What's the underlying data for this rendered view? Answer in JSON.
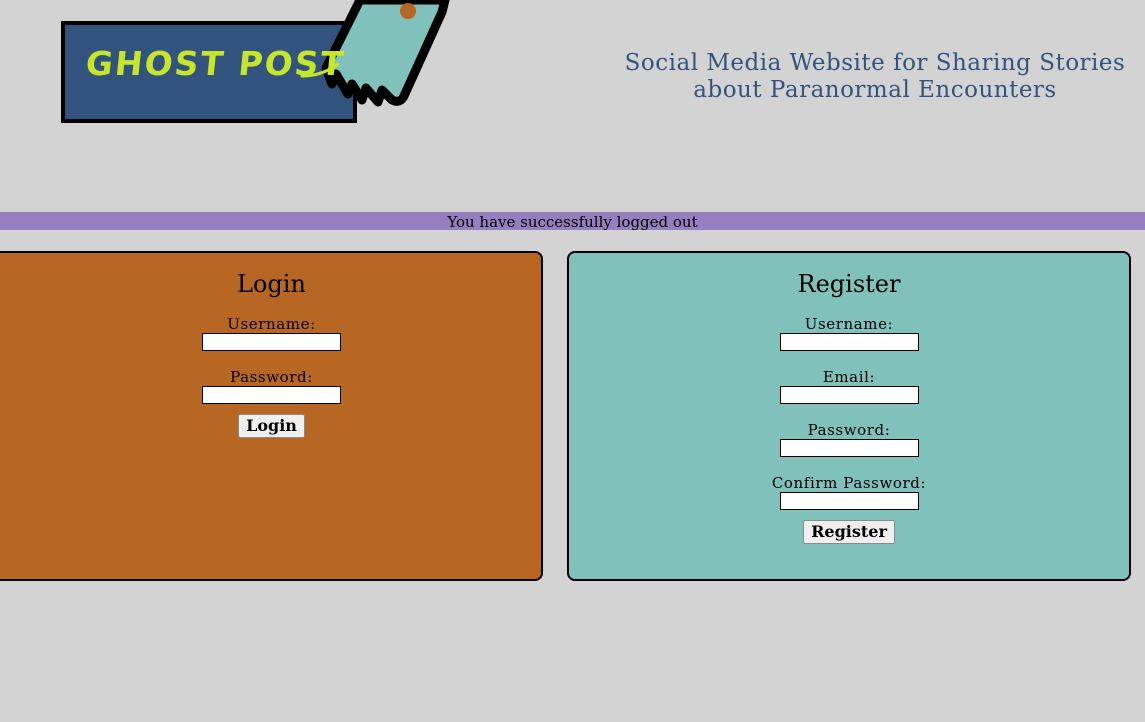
{
  "header": {
    "logo_text": "GHOST POST",
    "tagline_line1": "Social Media Website for Sharing Stories",
    "tagline_line2": "about Paranormal Encounters"
  },
  "message": {
    "text": "You have successfully logged out"
  },
  "login": {
    "title": "Login",
    "username_label": "Username:",
    "username_value": "",
    "password_label": "Password:",
    "password_value": "",
    "submit_label": "Login"
  },
  "register": {
    "title": "Register",
    "username_label": "Username:",
    "username_value": "",
    "email_label": "Email:",
    "email_value": "",
    "password_label": "Password:",
    "password_value": "",
    "confirm_label": "Confirm Password:",
    "confirm_value": "",
    "submit_label": "Register"
  },
  "colors": {
    "background": "#d3d3d3",
    "brand_navy": "#33537f",
    "logo_green": "#c5e62a",
    "ghost_teal": "#81c1bb",
    "message_bar": "#967ebf",
    "login_panel": "#b76623",
    "register_panel": "#81c1bb"
  }
}
